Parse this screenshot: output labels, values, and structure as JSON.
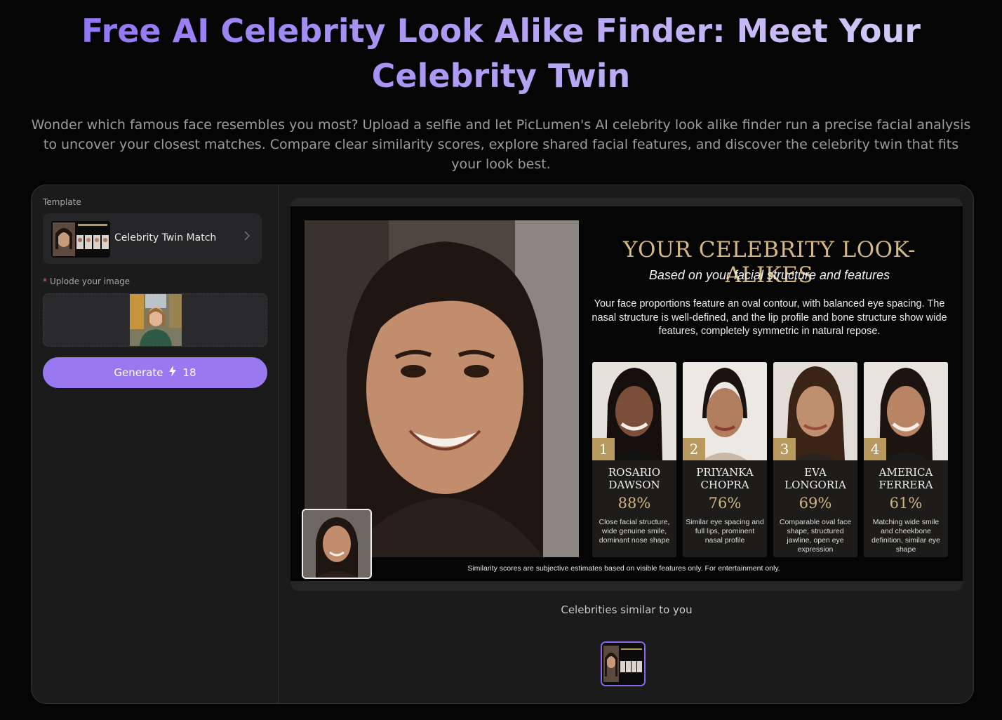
{
  "hero": {
    "title": "Free AI Celebrity Look Alike Finder: Meet Your Celebrity Twin",
    "description": "Wonder which famous face resembles you most? Upload a selfie and let PicLumen's AI celebrity look alike finder run a precise facial analysis to uncover your closest matches. Compare clear similarity scores, explore shared facial features, and discover the celebrity twin that fits your look best."
  },
  "sidebar": {
    "template_label": "Template",
    "template_name": "Celebrity Twin Match",
    "upload_required_mark": "*",
    "upload_label": "Uplode your image",
    "generate_label": "Generate",
    "generate_credits": "18"
  },
  "poster": {
    "title": "YOUR CELEBRITY LOOK-ALIKES",
    "subtitle": "Based on your facial structure and features",
    "analysis": "Your face proportions feature an oval contour, with balanced eye spacing. The nasal structure is well-defined, and the lip profile and bone structure show wide features, completely symmetric in natural repose.",
    "celebrities": [
      {
        "rank": "1",
        "name": "ROSARIO DAWSON",
        "score": "88%",
        "desc": "Close facial structure, wide genuine smile, dominant nose shape"
      },
      {
        "rank": "2",
        "name": "PRIYANKA CHOPRA",
        "score": "76%",
        "desc": "Similar eye spacing and full lips, prominent nasal profile"
      },
      {
        "rank": "3",
        "name": "EVA LONGORIA",
        "score": "69%",
        "desc": "Comparable oval face shape, structured jawline, open eye expression"
      },
      {
        "rank": "4",
        "name": "AMERICA FERRERA",
        "score": "61%",
        "desc": "Matching wide smile and cheekbone definition, similar eye shape"
      }
    ],
    "disclaimer": "Similarity scores are subjective estimates based on visible features only. For entertainment only."
  },
  "results": {
    "caption": "Celebrities similar to you"
  },
  "colors": {
    "accent": "#9a78f0",
    "gold": "#d3b57e",
    "background": "#050506",
    "panel": "#1b1b1c"
  },
  "icons": {
    "chevron": "chevron-right-icon",
    "credits": "lightning-icon"
  }
}
